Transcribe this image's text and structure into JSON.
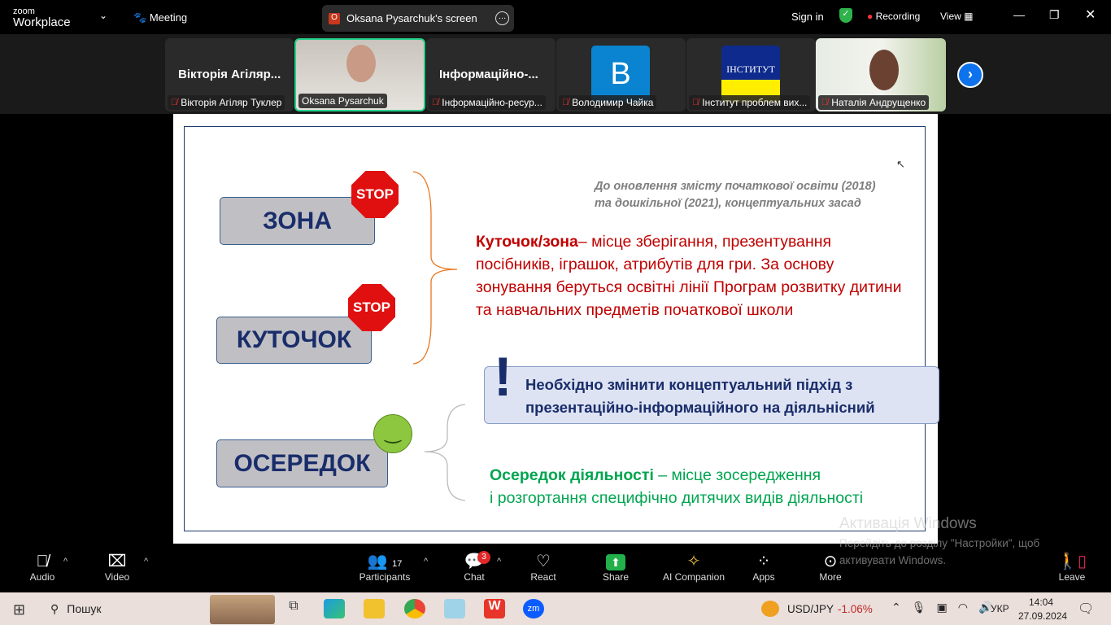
{
  "app": {
    "logo_small": "zoom",
    "logo_big": "Workplace",
    "meeting_label": "Meeting",
    "share_banner": "Oksana Pysarchuk's screen",
    "share_initial": "O",
    "sign_in": "Sign in",
    "recording": "Recording",
    "view": "View"
  },
  "participants": [
    {
      "big": "Вікторія Агіляр...",
      "label": "Вікторія Агіляр Туклер",
      "muted": true
    },
    {
      "big": "",
      "label": "Oksana Pysarchuk",
      "muted": false,
      "active": true
    },
    {
      "big": "Інформаційно-...",
      "label": "Інформаційно-ресур...",
      "muted": true
    },
    {
      "big": "B",
      "label": "Володимир Чайка",
      "muted": true,
      "avatar_color": "#0a84d0"
    },
    {
      "big": "ІНСТИТУТ",
      "label": "Інститут проблем вих...",
      "muted": true
    },
    {
      "big": "",
      "label": "Наталія Андрущенко",
      "muted": true
    }
  ],
  "slide": {
    "zone": "ЗОНА",
    "corner": "КУТОЧОК",
    "center": "ОСЕРЕДОК",
    "stop": "STOP",
    "note_line1": "До оновлення змісту початкової освіти (2018)",
    "note_line2": "та дошкільної (2021), концептуальних засад",
    "def_term": "Куточок/зона",
    "def_text": "– місце зберігання, презентування посібників, іграшок, атрибутів для гри. За основу зонування беруться освітні лінії Програм розвитку дитини та навчальних предметів початкової школи",
    "callout_mark": "!",
    "callout_line1": "Необхідно змінити концептуальний підхід з",
    "callout_line2": "презентаційно-інформаційного на діяльнісний",
    "center_term": "Осередок діяльності",
    "center_text1": " – місце зосередження",
    "center_text2": "і розгортання специфічно дитячих видів діяльності"
  },
  "watermark": {
    "title": "Активація Windows",
    "line1": "Перейдіть до розділу \"Настройки\", щоб",
    "line2": "активувати Windows."
  },
  "toolbar": {
    "audio": "Audio",
    "video": "Video",
    "participants": "Participants",
    "participants_count": "17",
    "chat": "Chat",
    "chat_badge": "3",
    "react": "React",
    "share": "Share",
    "ai": "AI Companion",
    "apps": "Apps",
    "more": "More",
    "leave": "Leave"
  },
  "taskbar": {
    "search": "Пошук",
    "ticker": "USD/JPY",
    "ticker_change": "-1.06%",
    "lang": "УКР",
    "time": "14:04",
    "date": "27.09.2024"
  },
  "colors": {
    "accent_green": "#23d18b",
    "slide_red": "#c00000",
    "slide_green": "#00a550",
    "slide_navy": "#1a2d6b"
  }
}
